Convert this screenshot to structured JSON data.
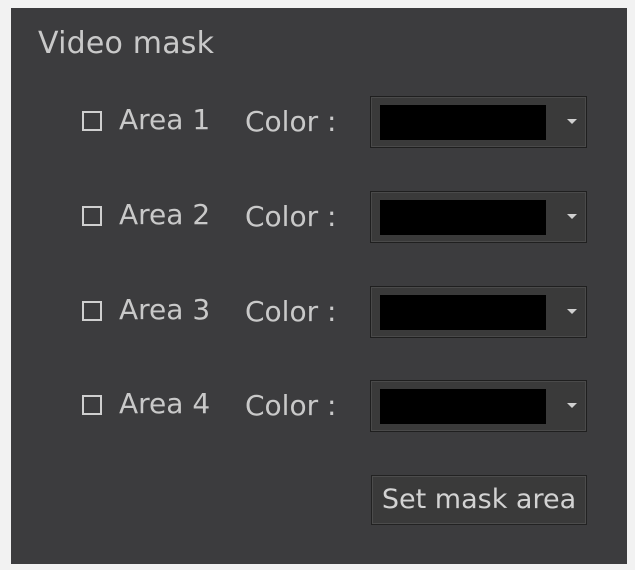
{
  "panel": {
    "title": "Video mask"
  },
  "areas": [
    {
      "label": "Area 1",
      "color_label": "Color :",
      "color": "#000000",
      "checked": false
    },
    {
      "label": "Area 2",
      "color_label": "Color :",
      "color": "#000000",
      "checked": false
    },
    {
      "label": "Area 3",
      "color_label": "Color :",
      "color": "#000000",
      "checked": false
    },
    {
      "label": "Area 4",
      "color_label": "Color :",
      "color": "#000000",
      "checked": false
    }
  ],
  "actions": {
    "set_mask_label": "Set mask area"
  },
  "icons": {
    "checkbox": "checkbox-empty-icon",
    "dropdown": "chevron-down-icon"
  }
}
